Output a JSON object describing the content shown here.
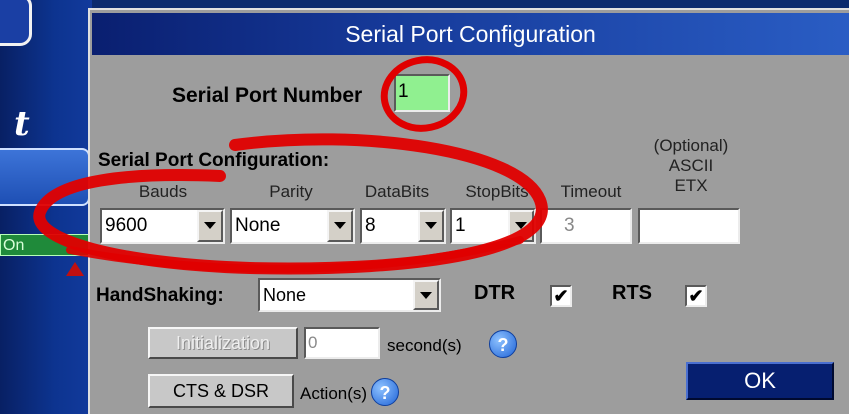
{
  "background": {
    "letter": "t",
    "on_label": "On"
  },
  "dialog": {
    "title": "Serial Port Configuration",
    "port_number_label": "Serial Port Number",
    "port_number_value": "1",
    "section_label": "Serial Port Configuration:",
    "headers": {
      "bauds": "Bauds",
      "parity": "Parity",
      "databits": "DataBits",
      "stopbits": "StopBits",
      "timeout": "Timeout",
      "optional_line1": "(Optional)",
      "optional_line2": "ASCII",
      "optional_line3": "ETX"
    },
    "values": {
      "bauds": "9600",
      "parity": "None",
      "databits": "8",
      "stopbits": "1",
      "timeout": "3",
      "etx": ""
    },
    "handshaking_label": "HandShaking:",
    "handshaking_value": "None",
    "dtr_label": "DTR",
    "dtr_checked": "✔",
    "rts_label": "RTS",
    "rts_checked": "✔",
    "initialization_button": "Initialization",
    "initialization_value": "0",
    "seconds_label": "second(s)",
    "cts_dsr_button": "CTS & DSR",
    "actions_label": "Action(s)",
    "help_glyph": "?",
    "ok_button": "OK"
  },
  "colors": {
    "title_bar": "#0a1f70",
    "dialog_bg": "#9d9d9d",
    "port_field": "#90f090",
    "annotation_red": "#e00000"
  },
  "icons": [
    "help-icon",
    "dropdown-arrow-icon",
    "checkmark-icon"
  ]
}
